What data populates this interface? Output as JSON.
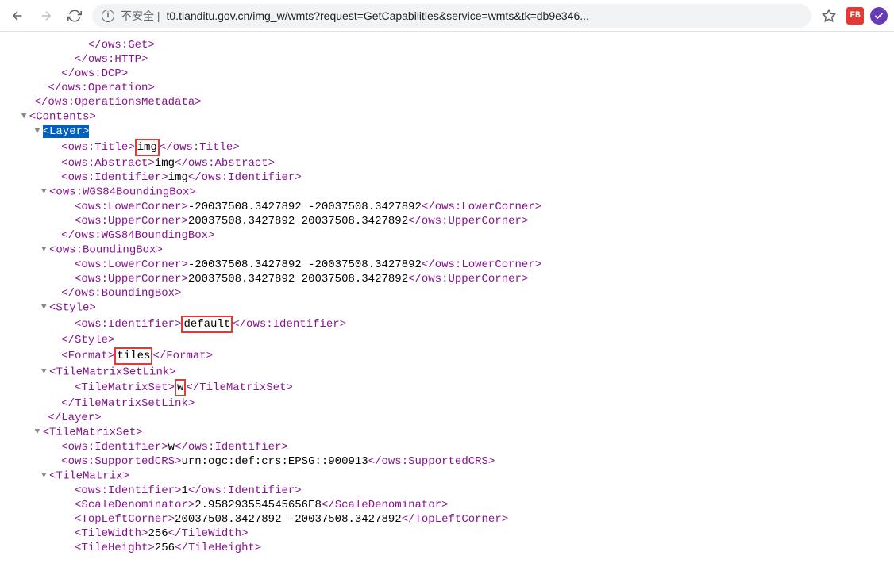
{
  "toolbar": {
    "security_label": "不安全",
    "url": "t0.tianditu.gov.cn/img_w/wmts?request=GetCapabilities&service=wmts&tk=db9e346..."
  },
  "xml": {
    "get_close": "</ows:Get>",
    "http_close": "</ows:HTTP>",
    "dcp_close": "</ows:DCP>",
    "operation_close": "</ows:Operation>",
    "opsmeta_close": "</ows:OperationsMetadata>",
    "contents_open": "<Contents>",
    "layer_open": "<Layer>",
    "title_open": "<ows:Title>",
    "title_val": "img",
    "title_close": "</ows:Title>",
    "abstract_open": "<ows:Abstract>",
    "abstract_val": "img",
    "abstract_close": "</ows:Abstract>",
    "identifier_open": "<ows:Identifier>",
    "identifier_img_val": "img",
    "identifier_close": "</ows:Identifier>",
    "wgs84_open": "<ows:WGS84BoundingBox>",
    "lowercorner_open": "<ows:LowerCorner>",
    "lowercorner_val": "-20037508.3427892 -20037508.3427892",
    "lowercorner_close": "</ows:LowerCorner>",
    "uppercorner_open": "<ows:UpperCorner>",
    "uppercorner_val": "20037508.3427892 20037508.3427892",
    "uppercorner_close": "</ows:UpperCorner>",
    "wgs84_close": "</ows:WGS84BoundingBox>",
    "bbox_open": "<ows:BoundingBox>",
    "bbox_close": "</ows:BoundingBox>",
    "style_open": "<Style>",
    "style_close": "</Style>",
    "identifier_default_val": "default",
    "format_open": "<Format>",
    "format_val": "tiles",
    "format_close": "</Format>",
    "tmslink_open": "<TileMatrixSetLink>",
    "tms_open": "<TileMatrixSet>",
    "tms_val": "w",
    "tms_close": "</TileMatrixSet>",
    "tmslink_close": "</TileMatrixSetLink>",
    "layer_close": "</Layer>",
    "tmsblock_open": "<TileMatrixSet>",
    "identifier_w_val": "w",
    "supportedcrs_open": "<ows:SupportedCRS>",
    "supportedcrs_val": "urn:ogc:def:crs:EPSG::900913",
    "supportedcrs_close": "</ows:SupportedCRS>",
    "tilematrix_open": "<TileMatrix>",
    "identifier_1_val": "1",
    "scaledenom_open": "<ScaleDenominator>",
    "scaledenom_val": "2.958293554545656E8",
    "scaledenom_close": "</ScaleDenominator>",
    "topleft_open": "<TopLeftCorner>",
    "topleft_val": "20037508.3427892 -20037508.3427892",
    "topleft_close": "</TopLeftCorner>",
    "tilewidth_open": "<TileWidth>",
    "tilewidth_val": "256",
    "tilewidth_close": "</TileWidth>",
    "tileheight_open": "<TileHeight>",
    "tileheight_val": "256",
    "tileheight_close": "</TileHeight>"
  },
  "indents": {
    "i6": "            ",
    "i5": "          ",
    "i4": "        ",
    "i3": "      ",
    "i2": "    ",
    "i1": "  ",
    "i3t": "     ",
    "i4t": "       ",
    "i5t": "         "
  }
}
